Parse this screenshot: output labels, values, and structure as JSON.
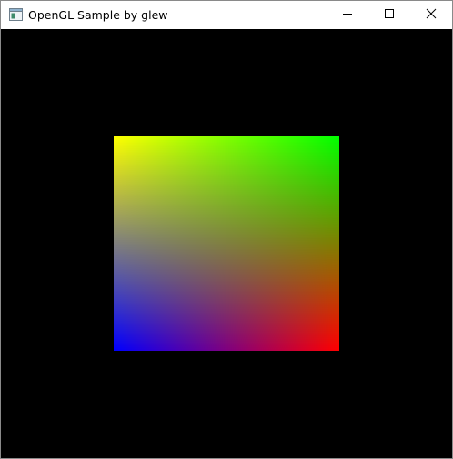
{
  "window": {
    "title": "OpenGL Sample by glew",
    "icons": {
      "app": "app-window-icon",
      "minimize": "minimize-icon",
      "maximize": "maximize-icon",
      "close": "close-icon"
    }
  },
  "viewport": {
    "background": "#000000",
    "quad_corner_colors": {
      "top_left": "#ffff00",
      "top_right": "#00ff00",
      "bottom_left": "#0000ff",
      "bottom_right": "#ff0000"
    }
  }
}
